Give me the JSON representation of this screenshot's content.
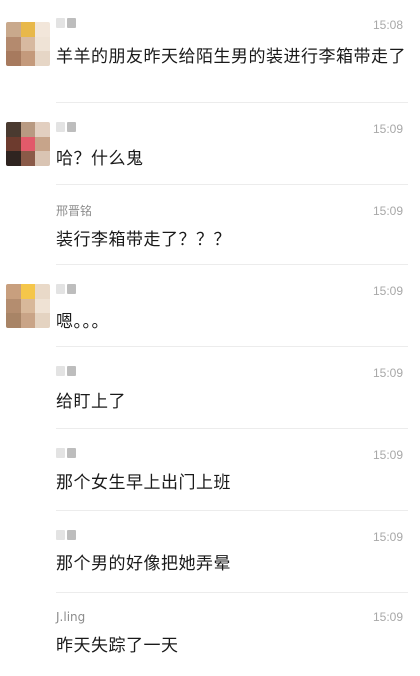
{
  "messages": [
    {
      "name": "",
      "time": "15:08",
      "text": "羊羊的朋友昨天给陌生男的装进行李箱带走了"
    },
    {
      "name": "",
      "time": "15:09",
      "text": "哈？什么鬼"
    },
    {
      "name": "邢晋铭",
      "time": "15:09",
      "text": "装行李箱带走了？？？"
    },
    {
      "name": "",
      "time": "15:09",
      "text": "嗯。。。"
    },
    {
      "name": "",
      "time": "15:09",
      "text": "给盯上了"
    },
    {
      "name": "",
      "time": "15:09",
      "text": "那个女生早上出门上班"
    },
    {
      "name": "",
      "time": "15:09",
      "text": "那个男的好像把她弄晕"
    },
    {
      "name": "J.ling",
      "time": "15:09",
      "text": "昨天失踪了一天"
    }
  ],
  "colors": {
    "avatar1": [
      "#c9a98c",
      "#e8d2b8",
      "#f2e6da",
      "#b48a6e",
      "#d7b9a0",
      "#efe3d6",
      "#a77a5e",
      "#c49a7c",
      "#e6d6c6"
    ],
    "avatar2": [
      "#4a3a30",
      "#b89a82",
      "#e2cfc0",
      "#6d3b2e",
      "#e25a6a",
      "#c7a48a",
      "#2f2420",
      "#8a5a48",
      "#d9c4b3"
    ],
    "avatar3": [
      "#c89f7e",
      "#f5c64a",
      "#e9d9c8",
      "#b48d6f",
      "#d8b89a",
      "#efe2d4",
      "#a88466",
      "#c9a487",
      "#e4d3c1"
    ]
  }
}
